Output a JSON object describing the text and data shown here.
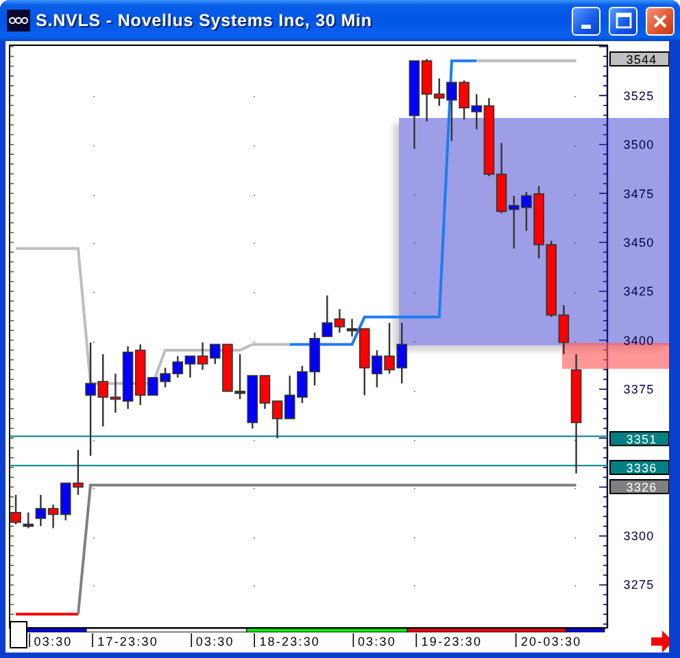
{
  "window": {
    "title": "S.NVLS - Novellus Systems Inc, 30 Min"
  },
  "chart": {
    "chart_data": {
      "type": "candlestick",
      "categories": [
        null,
        null,
        null,
        "03:30",
        null,
        null,
        null,
        null,
        null,
        "17-23:30",
        null,
        null,
        null,
        null,
        null,
        null,
        "03:30",
        null,
        null,
        null,
        null,
        null,
        "18-23:30",
        null,
        null,
        null,
        null,
        null,
        null,
        "03:30",
        null,
        null,
        null,
        null,
        null,
        "19-23:30",
        null,
        null,
        null,
        null,
        null,
        null,
        null,
        "20-03:30",
        null,
        null,
        null,
        null
      ],
      "ohlc": [
        [
          3312,
          3321,
          3306,
          3307
        ],
        [
          3306,
          3312,
          3304,
          3306
        ],
        [
          3309,
          3321,
          3305,
          3314
        ],
        [
          3314,
          3316,
          3304,
          3311
        ],
        [
          3311,
          3327,
          3308,
          3327
        ],
        [
          3327,
          3344,
          3321,
          3325
        ],
        [
          3372,
          3399,
          3341,
          3378
        ],
        [
          3379,
          3393,
          3356,
          3371
        ],
        [
          3371,
          3383,
          3363,
          3370
        ],
        [
          3369,
          3397,
          3365,
          3394
        ],
        [
          3395,
          3398,
          3367,
          3372
        ],
        [
          3372,
          3381,
          3372,
          3381
        ],
        [
          3379,
          3386,
          3376,
          3383
        ],
        [
          3383,
          3392,
          3381,
          3389
        ],
        [
          3388,
          3392,
          3381,
          3392
        ],
        [
          3392,
          3399,
          3385,
          3388
        ],
        [
          3391,
          3398,
          3388,
          3398
        ],
        [
          3398,
          3398,
          3374,
          3374
        ],
        [
          3374,
          3393,
          3370,
          3374
        ],
        [
          3358,
          3382,
          3355,
          3382
        ],
        [
          3382,
          3382,
          3365,
          3368
        ],
        [
          3369,
          3369,
          3350,
          3360
        ],
        [
          3360,
          3382,
          3360,
          3372
        ],
        [
          3371,
          3387,
          3368,
          3384
        ],
        [
          3384,
          3404,
          3377,
          3401
        ],
        [
          3402,
          3423,
          3402,
          3409
        ],
        [
          3411,
          3416,
          3404,
          3407
        ],
        [
          3406,
          3411,
          3402,
          3406
        ],
        [
          3406,
          3406,
          3372,
          3386
        ],
        [
          3383,
          3395,
          3376,
          3392
        ],
        [
          3392,
          3409,
          3383,
          3385
        ],
        [
          3386,
          3409,
          3378,
          3398
        ],
        [
          3515,
          3543,
          3498,
          3543
        ],
        [
          3543,
          3544,
          3512,
          3526
        ],
        [
          3526,
          3534,
          3520,
          3524
        ],
        [
          3523,
          3532,
          3502,
          3532
        ],
        [
          3532,
          3533,
          3513,
          3519
        ],
        [
          3517,
          3526,
          3508,
          3520
        ],
        [
          3520,
          3524,
          3484,
          3485
        ],
        [
          3485,
          3501,
          3465,
          3466
        ],
        [
          3467,
          3474,
          3447,
          3469
        ],
        [
          3468,
          3476,
          3456,
          3474
        ],
        [
          3475,
          3479,
          3442,
          3449
        ],
        [
          3449,
          3451,
          3412,
          3413
        ],
        [
          3413,
          3418,
          3393,
          3399
        ],
        [
          3385,
          3393,
          3332,
          3358
        ],
        null,
        null
      ],
      "series": [
        {
          "type": "line",
          "color": "#bdbdbd",
          "values": [
            3447,
            3447,
            3447,
            3447,
            3447,
            3447,
            3378,
            3378,
            3378,
            3378,
            3378,
            3378,
            3395,
            3395,
            3395,
            3395,
            3395,
            3395,
            3395,
            3398,
            3398,
            3398,
            3398,
            null,
            null,
            null,
            null,
            null,
            null,
            null,
            null,
            null,
            null,
            null,
            null,
            null,
            null,
            null,
            null,
            null,
            null,
            null,
            null,
            null,
            null,
            null,
            null,
            null
          ]
        },
        {
          "type": "line",
          "color": "#1e7cf0",
          "values": [
            null,
            null,
            null,
            null,
            null,
            null,
            null,
            null,
            null,
            null,
            null,
            null,
            null,
            null,
            null,
            null,
            null,
            null,
            null,
            null,
            null,
            null,
            3398,
            3398,
            3398,
            3398,
            3398,
            3398,
            3412,
            3412,
            3412,
            3412,
            3412,
            3412,
            3412,
            3543,
            3543,
            3543,
            null,
            null,
            null,
            null,
            null,
            null,
            null,
            null,
            null,
            null
          ]
        },
        {
          "type": "line",
          "color": "#bdbdbd",
          "values": [
            null,
            null,
            null,
            null,
            null,
            null,
            null,
            null,
            null,
            null,
            null,
            null,
            null,
            null,
            null,
            null,
            null,
            null,
            null,
            null,
            null,
            null,
            null,
            null,
            null,
            null,
            null,
            null,
            null,
            null,
            null,
            null,
            null,
            null,
            null,
            null,
            null,
            3543,
            3543,
            3543,
            3543,
            3543,
            3543,
            3543,
            3543,
            3543,
            null,
            null
          ]
        },
        {
          "type": "line",
          "color": "#ff0000",
          "values": [
            3260,
            3260,
            3260,
            3260,
            3260,
            3260,
            null,
            null,
            null,
            null,
            null,
            null,
            null,
            null,
            null,
            null,
            null,
            null,
            null,
            null,
            null,
            null,
            null,
            null,
            null,
            null,
            null,
            null,
            null,
            null,
            null,
            null,
            null,
            null,
            null,
            null,
            null,
            null,
            null,
            null,
            null,
            null,
            null,
            null,
            null,
            null,
            null,
            null
          ]
        },
        {
          "type": "line",
          "color": "#808080",
          "values": [
            null,
            null,
            null,
            null,
            null,
            3260,
            3326,
            3326,
            3326,
            3326,
            3326,
            3326,
            3326,
            3326,
            3326,
            3326,
            3326,
            3326,
            3326,
            3326,
            3326,
            3326,
            3326,
            3326,
            3326,
            3326,
            3326,
            3326,
            3326,
            3326,
            3326,
            3326,
            3326,
            3326,
            3326,
            3326,
            3326,
            3326,
            3326,
            3326,
            3326,
            3326,
            3326,
            3326,
            3326,
            3326,
            null,
            null
          ]
        }
      ],
      "ref_lines": [
        {
          "axis": "y",
          "value": 3351,
          "color": "#008080"
        },
        {
          "axis": "y",
          "value": 3336,
          "color": "#008080"
        }
      ],
      "ylim": [
        3253,
        3551
      ],
      "yticks": [
        3525,
        3500,
        3475,
        3450,
        3425,
        3400,
        3375,
        3300,
        3275
      ]
    }
  },
  "price_markers": [
    {
      "label": "3544",
      "color": "#c0c0c0"
    },
    {
      "label": "3351",
      "color": "#008080"
    },
    {
      "label": "3336",
      "color": "#008080"
    },
    {
      "label": "3326",
      "color": "#808080"
    }
  ],
  "time_axis": {
    "sessions": [
      {
        "color": "#0000ff"
      },
      {
        "color": "#ffffff"
      },
      {
        "color": "#00ff00"
      },
      {
        "color": "#ff0000"
      },
      {
        "color": "#0000ff"
      }
    ]
  }
}
